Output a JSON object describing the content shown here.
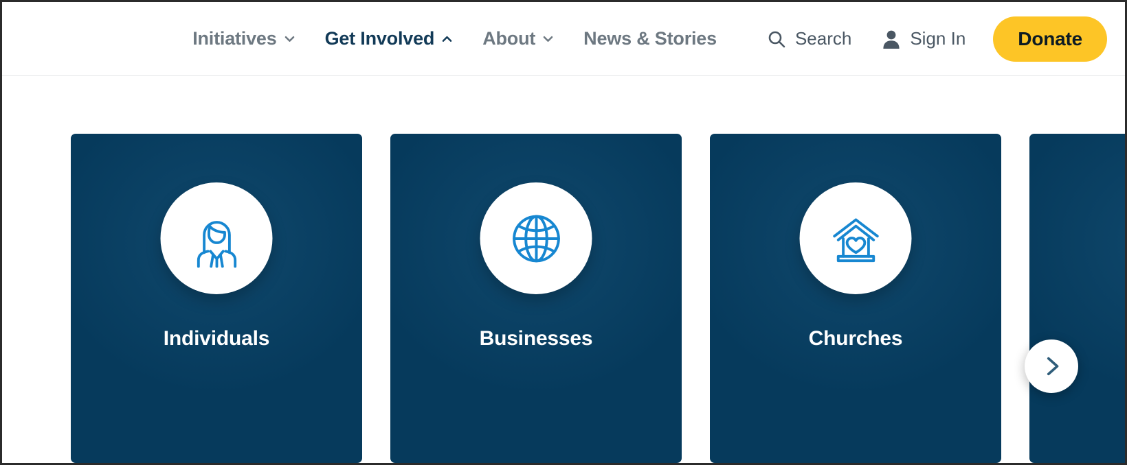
{
  "header": {
    "nav_items": [
      {
        "label": "Initiatives",
        "icon": "chevron-down-icon",
        "expanded": false,
        "active": false
      },
      {
        "label": "Get Involved",
        "icon": "chevron-up-icon",
        "expanded": true,
        "active": true
      },
      {
        "label": "About",
        "icon": "chevron-down-icon",
        "expanded": false,
        "active": false
      },
      {
        "label": "News & Stories",
        "icon": "none",
        "expanded": false,
        "active": false
      }
    ],
    "utility": {
      "search_label": "Search",
      "search_icon": "search-icon",
      "signin_label": "Sign In",
      "signin_icon": "user-icon",
      "donate_label": "Donate"
    }
  },
  "carousel": {
    "next_label": "Next",
    "next_icon": "chevron-right-icon",
    "cards": [
      {
        "title": "Individuals",
        "icon": "person-icon"
      },
      {
        "title": "Businesses",
        "icon": "globe-icon"
      },
      {
        "title": "Churches",
        "icon": "church-home-heart-icon"
      },
      {
        "title": "",
        "icon": "none"
      }
    ]
  },
  "colors": {
    "card_navy": "#063a5c",
    "icon_blue": "#1787d1",
    "donate_yellow": "#fdc526",
    "nav_inactive": "#6d7881",
    "nav_active": "#123a57",
    "utility_text": "#4a5763"
  }
}
